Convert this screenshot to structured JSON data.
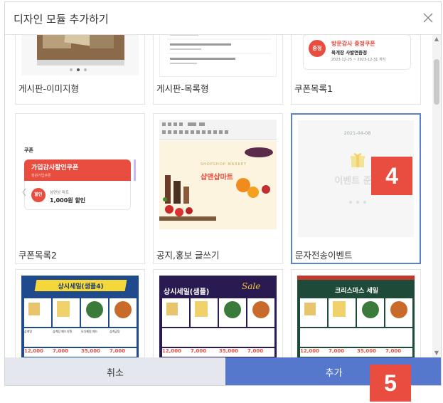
{
  "dialog": {
    "title": "디자인 모듈 추가하기",
    "cancel_label": "취소",
    "add_label": "추가"
  },
  "cards": [
    {
      "label": "게시판-이미지형"
    },
    {
      "label": "게시판-목록형"
    },
    {
      "label": "쿠폰목록1"
    },
    {
      "label": "쿠폰목록2"
    },
    {
      "label": "공지,홍보 글쓰기"
    },
    {
      "label": "문자전송이벤트",
      "selected": true
    }
  ],
  "thumbs": {
    "coupon1": {
      "badge": "증정",
      "title": "방문감사 증정쿠폰",
      "subtitle": "육개장 사발면증정",
      "date": "2023-12-25 ~ 2023-12-31 까지"
    },
    "coupon2": {
      "header": "쿠폰",
      "banner_title": "가입감사할인쿠폰",
      "banner_sub": "회원가입쿠폰",
      "badge": "할인",
      "store": "삼연상 마트",
      "amount": "1,000원 할인"
    },
    "notice": {
      "sub": "SHOPSHOP MARKET",
      "title": "샵앤샵마트"
    },
    "sms": {
      "date": "2021-04-08",
      "title": "이벤트 준비"
    },
    "sale1": {
      "title": "상시세일(샘플4)"
    },
    "sale2": {
      "title": "상시세일(샘플)",
      "script": "Sale"
    },
    "sale3": {
      "title": "크리스마스 세일"
    },
    "prices": [
      "12,000",
      "7,000",
      "35,000",
      "7,000"
    ],
    "product_names": [
      "삼계탕",
      "삼계탕 폐드치켓",
      "모다폐원 폐드",
      "유해등",
      "삼계곰탕"
    ]
  },
  "annotations": {
    "step4": "4",
    "step5": "5"
  },
  "colors": {
    "accent": "#5577cc",
    "badge": "#e94d3f",
    "selected_border": "#5b7fd1"
  }
}
